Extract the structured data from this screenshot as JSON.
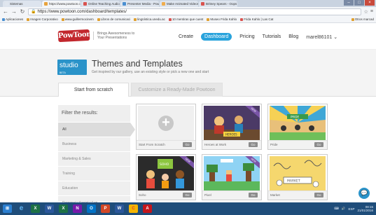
{
  "browser": {
    "tabs": [
      {
        "label": "Sistemas",
        "color": "#e0e6ee"
      },
      {
        "label": "https://www.powtoon.com",
        "color": "#e8a33d",
        "active": true
      },
      {
        "label": "Online Teaching Audio",
        "color": "#d9534f"
      },
      {
        "label": "Presenter Media - PowerP",
        "color": "#4a8fd1"
      },
      {
        "label": "Make Animated Videos",
        "color": "#f0ad4e"
      },
      {
        "label": "Britney Spears - Oops",
        "color": "#d9534f"
      }
    ],
    "url": "https://www.powtoon.com/dashboard/templates/",
    "bookmarks": [
      "Aplicaciones",
      "Imagen Corporativo",
      "www.guillermocinem",
      "Libros de comunicaci",
      "lingüística.unedu.ac",
      "10 mentiras que cuent",
      "Museo Frida Kahlo",
      "Frida Kahlo | Las Cat"
    ],
    "bookmarks_other": "Otros marcad"
  },
  "header": {
    "logo": "PowToon",
    "tagline": "Brings Awesomeness to Your Presentations",
    "nav": {
      "create": "Create",
      "dashboard": "Dashboard",
      "pricing": "Pricing",
      "tutorials": "Tutorials",
      "blog": "Blog",
      "user": "marel86101"
    }
  },
  "banner": {
    "studio_label": "studio",
    "studio_badge": "BETA",
    "title": "Themes and Templates",
    "subtitle": "Get inspired by our gallery, use an existing style or pick a new one and start"
  },
  "tabs": {
    "start_from_scratch": "Start from scratch",
    "customize": "Customize a Ready-Made Powtoon"
  },
  "filter": {
    "title": "Filter the results:",
    "items": [
      "All",
      "Business",
      "Marketing & Sales",
      "Training",
      "Education",
      "Personal / Social / Fun"
    ],
    "selected_index": 0
  },
  "cards": [
    {
      "name": "Start From Scratch",
      "button": "Go",
      "ribbon": ""
    },
    {
      "name": "Heroes at Work",
      "button": "Go",
      "ribbon": "NEW"
    },
    {
      "name": "Pride",
      "button": "Go",
      "ribbon": ""
    },
    {
      "name": "Soho",
      "button": "Go",
      "ribbon": "NEW"
    },
    {
      "name": "Pixel",
      "button": "Go",
      "ribbon": "NEW"
    },
    {
      "name": "Market",
      "button": "Go",
      "ribbon": ""
    }
  ],
  "taskbar": {
    "apps": [
      "e",
      "X",
      "W",
      "X",
      "N",
      "O",
      "P",
      "W",
      "C",
      "A"
    ],
    "tray_lang": "ESP",
    "time": "08:15",
    "date": "21/01/2016"
  },
  "colors": {
    "powtoon_red": "#c2272d",
    "accent_blue": "#29a3dc",
    "studio_blue": "#2a93c9",
    "taskbar": "#1f4d7a"
  }
}
